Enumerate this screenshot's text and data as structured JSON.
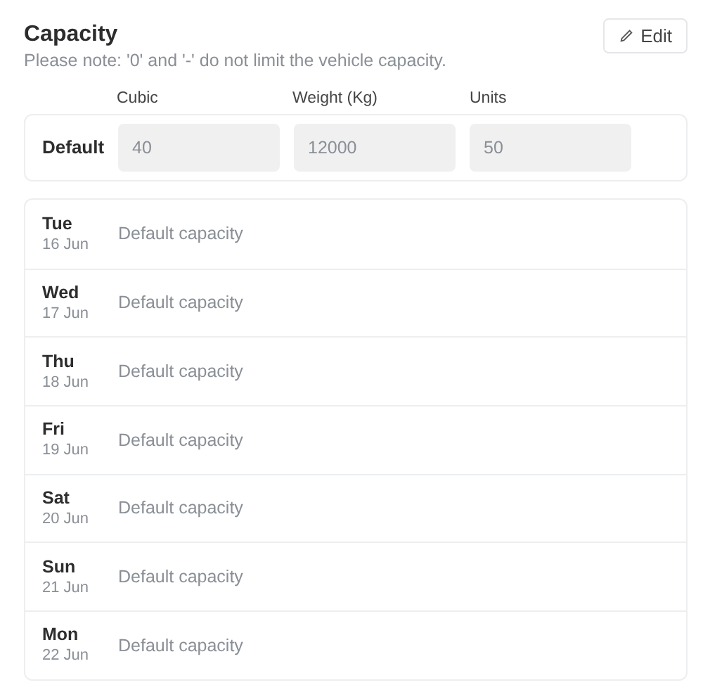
{
  "title": "Capacity",
  "note": "Please note: '0' and '-' do not limit the vehicle capacity.",
  "edit_button": "Edit",
  "columns": [
    "Cubic",
    "Weight (Kg)",
    "Units"
  ],
  "default_row": {
    "label": "Default",
    "fields": [
      {
        "value": "40",
        "disabled": true
      },
      {
        "value": "12000",
        "disabled": true
      },
      {
        "value": "50",
        "disabled": true
      }
    ]
  },
  "days": [
    {
      "day": "Tue",
      "date": "16 Jun",
      "capacity": "Default capacity"
    },
    {
      "day": "Wed",
      "date": "17 Jun",
      "capacity": "Default capacity"
    },
    {
      "day": "Thu",
      "date": "18 Jun",
      "capacity": "Default capacity"
    },
    {
      "day": "Fri",
      "date": "19 Jun",
      "capacity": "Default capacity"
    },
    {
      "day": "Sat",
      "date": "20 Jun",
      "capacity": "Default capacity"
    },
    {
      "day": "Sun",
      "date": "21 Jun",
      "capacity": "Default capacity"
    },
    {
      "day": "Mon",
      "date": "22 Jun",
      "capacity": "Default capacity"
    }
  ]
}
